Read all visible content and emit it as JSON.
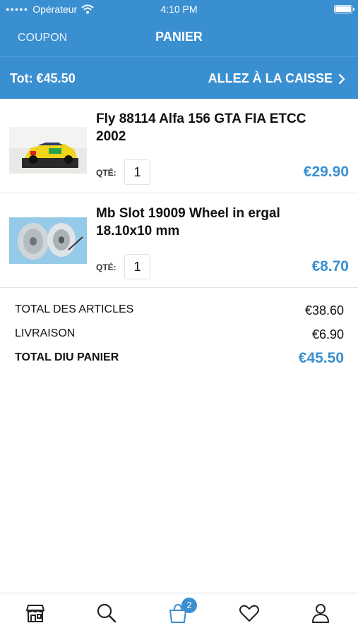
{
  "status_bar": {
    "carrier": "Opérateur",
    "time": "4:10 PM"
  },
  "nav": {
    "coupon_label": "COUPON",
    "title": "PANIER"
  },
  "total_bar": {
    "total": "Tot: €45.50",
    "checkout_label": "ALLEZ À LA CAISSE"
  },
  "items": [
    {
      "name": "Fly 88114 Alfa 156 GTA FIA ETCC 2002",
      "qty_label": "QTÉ:",
      "qty": "1",
      "price": "€29.90"
    },
    {
      "name": "Mb Slot 19009 Wheel in ergal 18.10x10 mm",
      "qty_label": "QTÉ:",
      "qty": "1",
      "price": "€8.70"
    }
  ],
  "summary": {
    "articles_label": "TOTAL DES ARTICLES",
    "articles_value": "€38.60",
    "shipping_label": "LIVRAISON",
    "shipping_value": "€6.90",
    "cart_label": "TOTAL DIU PANIER",
    "cart_value": "€45.50"
  },
  "tabs": [
    {
      "icon": "store-icon"
    },
    {
      "icon": "search-icon"
    },
    {
      "icon": "shopping-bag-icon",
      "badge": "2"
    },
    {
      "icon": "heart-icon"
    },
    {
      "icon": "user-icon"
    }
  ],
  "colors": {
    "accent": "#3a8fd0",
    "header_bg": "#3a8fd0"
  }
}
